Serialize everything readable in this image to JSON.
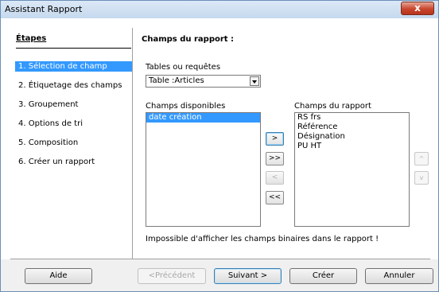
{
  "window": {
    "title": "Assistant Rapport",
    "close_label": "x"
  },
  "steps": {
    "heading": "Étapes",
    "items": [
      {
        "label": "1.  Sélection de champ",
        "active": true
      },
      {
        "label": "2.  Étiquetage des champs",
        "active": false
      },
      {
        "label": "3.  Groupement",
        "active": false
      },
      {
        "label": "4.  Options de tri",
        "active": false
      },
      {
        "label": "5.  Composition",
        "active": false
      },
      {
        "label": "6.  Créer un rapport",
        "active": false
      }
    ]
  },
  "main": {
    "title": "Champs du rapport :",
    "tables_label": "Tables ou requêtes",
    "tables_value": "Table :Articles",
    "available_label": "Champs disponibles",
    "available_fields": [
      "date création"
    ],
    "report_label": "Champs du rapport",
    "report_fields": [
      "RS frs",
      "Référence",
      "Désignation",
      "PU HT"
    ],
    "move_buttons": {
      "add_one": ">",
      "add_all": ">>",
      "remove_one": "<",
      "remove_all": "<<"
    },
    "order_buttons": {
      "up": "^",
      "down": "v"
    },
    "info_text": "Impossible d'afficher les champs binaires dans le rapport !"
  },
  "footer": {
    "help": "Aide",
    "previous": "<Précédent",
    "next": "Suivant >",
    "create": "Créer",
    "cancel": "Annuler"
  }
}
